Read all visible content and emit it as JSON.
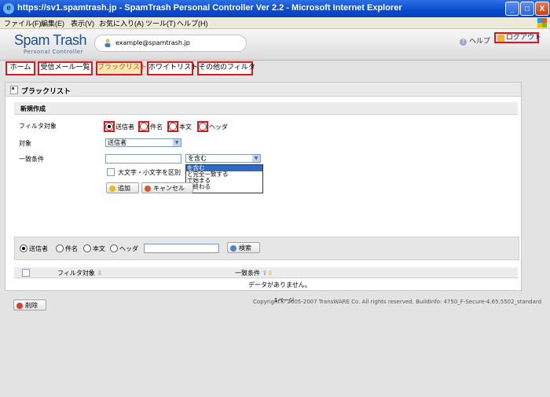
{
  "window": {
    "title": "https://sv1.spamtrash.jp - SpamTrash Personal Controller Ver 2.2 - Microsoft Internet Explorer",
    "minimize": "_",
    "maximize": "□",
    "close": "X"
  },
  "menu": [
    "ファイル(F)",
    "編集(E)",
    "表示(V)",
    "お気に入り(A)",
    "ツール(T)",
    "ヘルプ(H)"
  ],
  "header": {
    "logo_main": "Spam Trash",
    "logo_sub": "Personal Controller",
    "user_email": "example@spamtrash.jp",
    "help": "ヘルプ",
    "logout": "ログアウト"
  },
  "tabs": [
    {
      "label": "ホーム"
    },
    {
      "label": "受信メール一覧"
    },
    {
      "label": "ブラックリスト"
    },
    {
      "label": "ホワイトリスト"
    },
    {
      "label": "その他のフィルタ"
    }
  ],
  "panel": {
    "title": "ブラックリスト",
    "section": "新規作成",
    "filter_target_label": "フィルタ対象",
    "filter_options": [
      "送信者",
      "件名",
      "本文",
      "ヘッダ"
    ],
    "target_label": "対象",
    "target_value": "送信者",
    "match_label": "一致条件",
    "match_value": "を含む",
    "match_options": [
      "を含む",
      "と完全一致する",
      "で始まる",
      "で終わる"
    ],
    "case_label": "大文字・小文字を区別",
    "add_button": "追加",
    "cancel_button": "キャンセル"
  },
  "search": {
    "options": [
      "送信者",
      "件名",
      "本文",
      "ヘッダ"
    ],
    "button": "検索"
  },
  "table": {
    "col_filter": "フィルタ対象",
    "col_match": "一致条件",
    "empty": "データがありません。",
    "pages": "1ページ",
    "delete_button": "削除"
  },
  "footer": {
    "copyright": "Copyright© 2005-2007 TransWARE Co. All rights reserved. BuildInfo: 4750_F-Secure-4.65.5502_standard"
  },
  "colors": {
    "highlight_red": "#e0161e",
    "titlebar_blue": "#0a4ad0",
    "selected_blue": "#316ac5"
  }
}
